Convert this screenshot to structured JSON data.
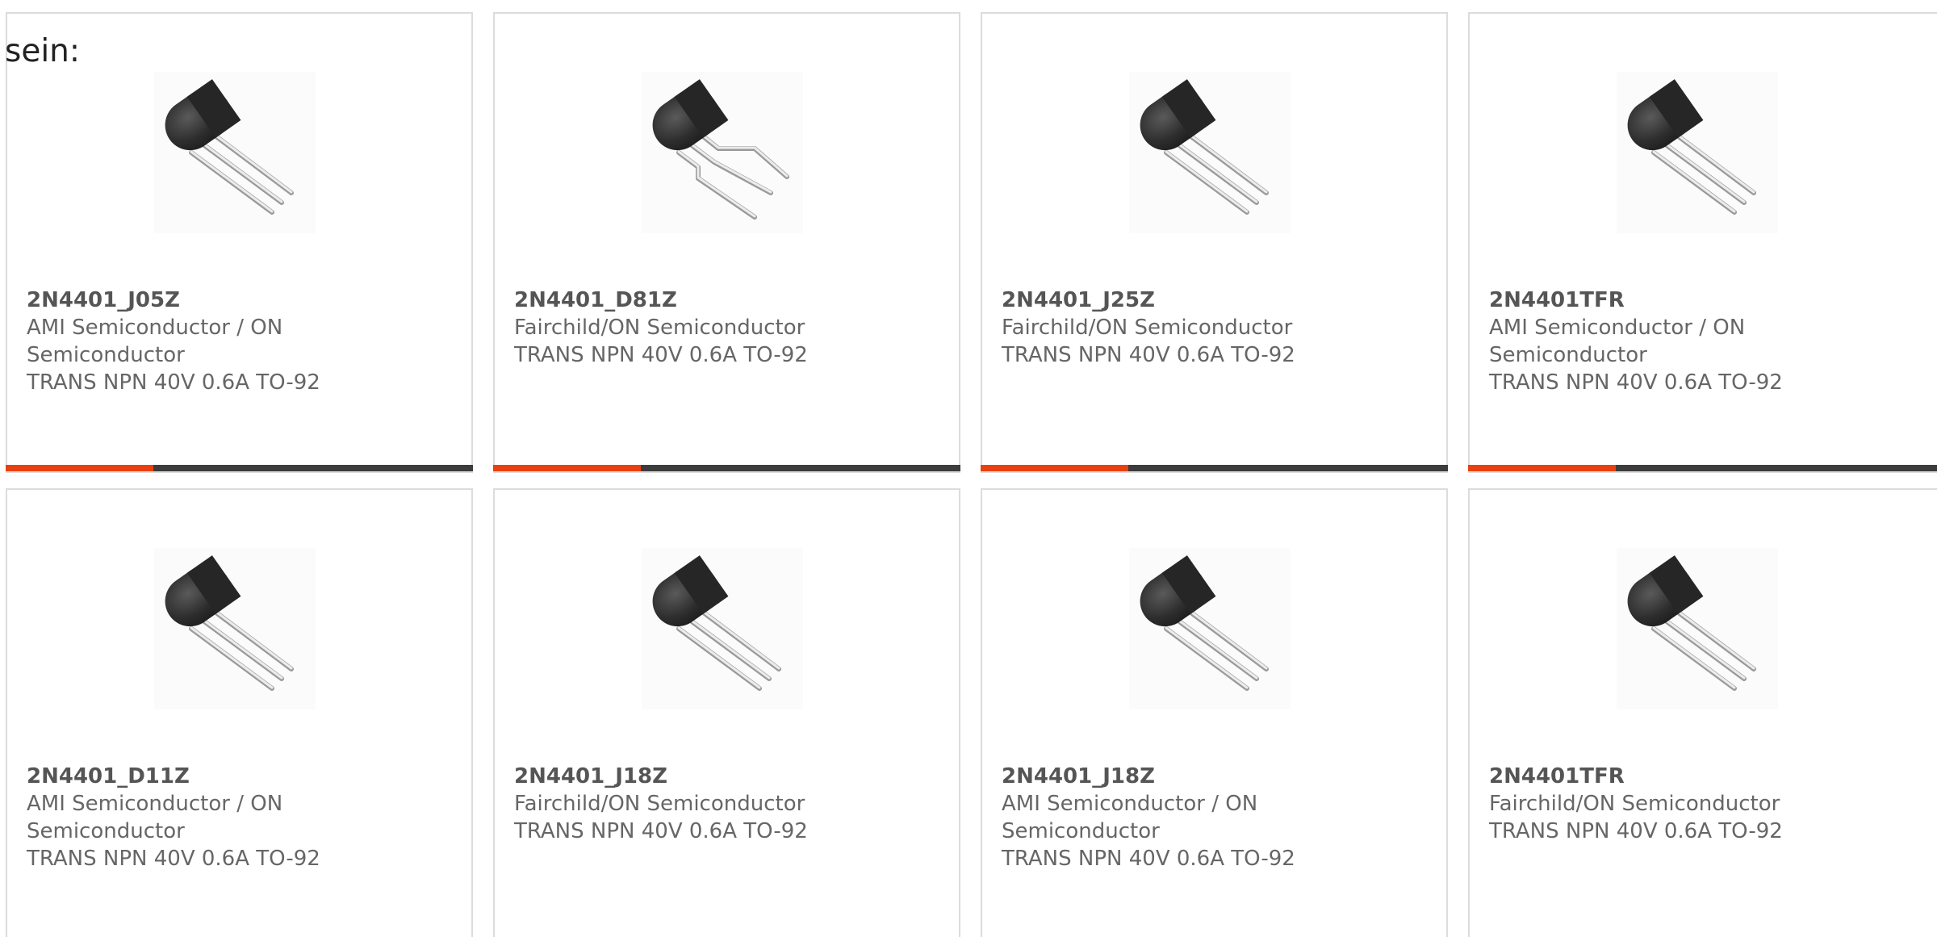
{
  "intro": {
    "text": "sein:"
  },
  "colors": {
    "accent": "#e8410f",
    "bar": "#3c3c3c",
    "text": "#666666"
  },
  "cards": [
    {
      "part_number": "2N4401_J05Z",
      "manufacturer": "AMI Semiconductor / ON Semiconductor",
      "description": "TRANS NPN 40V 0.6A TO-92",
      "image": "to92-transistor-straight-leads"
    },
    {
      "part_number": "2N4401_D81Z",
      "manufacturer": "Fairchild/ON Semiconductor",
      "description": "TRANS NPN 40V 0.6A TO-92",
      "image": "to92-transistor-bent-leads"
    },
    {
      "part_number": "2N4401_J25Z",
      "manufacturer": "Fairchild/ON Semiconductor",
      "description": "TRANS NPN 40V 0.6A TO-92",
      "image": "to92-transistor-straight-leads"
    },
    {
      "part_number": "2N4401TFR",
      "manufacturer": "AMI Semiconductor / ON Semiconductor",
      "description": "TRANS NPN 40V 0.6A TO-92",
      "image": "to92-transistor-straight-leads"
    },
    {
      "part_number": "2N4401_D11Z",
      "manufacturer": "AMI Semiconductor / ON Semiconductor",
      "description": "TRANS NPN 40V 0.6A TO-92",
      "image": "to92-transistor-straight-leads"
    },
    {
      "part_number": "2N4401_J18Z",
      "manufacturer": "Fairchild/ON Semiconductor",
      "description": "TRANS NPN 40V 0.6A TO-92",
      "image": "to92-transistor-straight-leads"
    },
    {
      "part_number": "2N4401_J18Z",
      "manufacturer": "AMI Semiconductor / ON Semiconductor",
      "description": "TRANS NPN 40V 0.6A TO-92",
      "image": "to92-transistor-straight-leads"
    },
    {
      "part_number": "2N4401TFR",
      "manufacturer": "Fairchild/ON Semiconductor",
      "description": "TRANS NPN 40V 0.6A TO-92",
      "image": "to92-transistor-straight-leads"
    }
  ]
}
